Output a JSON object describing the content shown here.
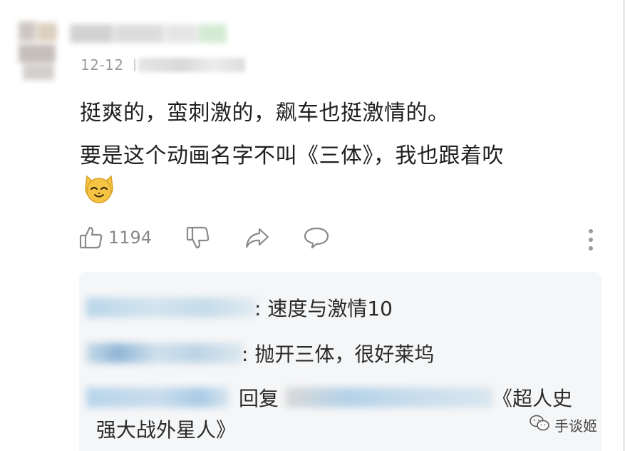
{
  "comment": {
    "date": "12-12",
    "text_line1": "挺爽的，蛮刺激的，飙车也挺激情的。",
    "text_line2": "要是这个动画名字不叫《三体》，我也跟着吹",
    "emoji": "cat-face-emoji"
  },
  "actions": {
    "like_count": "1194",
    "like_icon": "thumbs-up-icon",
    "dislike_icon": "thumbs-down-icon",
    "share_icon": "share-icon",
    "reply_icon": "comment-bubble-icon",
    "more_icon": "more-vertical-icon"
  },
  "replies": [
    {
      "text": ": 速度与激情10"
    },
    {
      "text": ": 抛开三体，很好莱坞"
    },
    {
      "prefix": "回复",
      "text_tail": "《超人史",
      "text_line2": "强大战外星人》"
    }
  ],
  "watermark": {
    "text": "手谈姬",
    "icon": "wechat-icon"
  },
  "colors": {
    "text": "#1f1f1f",
    "meta": "#9a9a9a",
    "icon": "#8a8a8a",
    "reply_bg": "#f5f6f7",
    "emoji": "#f6c343"
  }
}
